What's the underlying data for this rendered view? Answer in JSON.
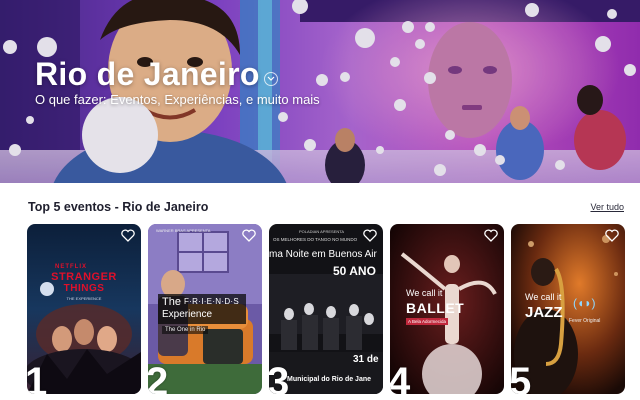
{
  "hero": {
    "title": "Rio de Janeiro",
    "subtitle": "O que fazer: Eventos, Experiências, e muito mais"
  },
  "section": {
    "title": "Top 5 eventos - Rio de Janeiro",
    "see_all": "Ver tudo"
  },
  "cards": [
    {
      "rank": "1",
      "brand": "NETFLIX",
      "title_line1": "STRANGER",
      "title_line2": "THINGS",
      "small": "THE EXPERIENCE"
    },
    {
      "rank": "2",
      "top": "WARNER BRAS APRESENTA",
      "title_the": "The",
      "title_friends": "F·R·I·E·N·D·S",
      "title_exp": "Experience",
      "sub": "The One in Rio"
    },
    {
      "rank": "3",
      "top1": "POLADIAN APRESENTA",
      "top2": "OS MELHORES DO TANGO NO MUNDO",
      "title": "ma Noite em Buenos Air",
      "years": "50 ANO",
      "date": "31 de",
      "venue": "Municipal do Rio de Jane"
    },
    {
      "rank": "4",
      "we": "We call it",
      "title": "BALLET",
      "badge": "A Bela Adormecida"
    },
    {
      "rank": "5",
      "we": "We call it",
      "title": "JAZZ",
      "badge": "Fever Original"
    }
  ],
  "colors": {
    "hero_purple": "#7b3fc9",
    "text_dark": "#1f1f2e"
  }
}
